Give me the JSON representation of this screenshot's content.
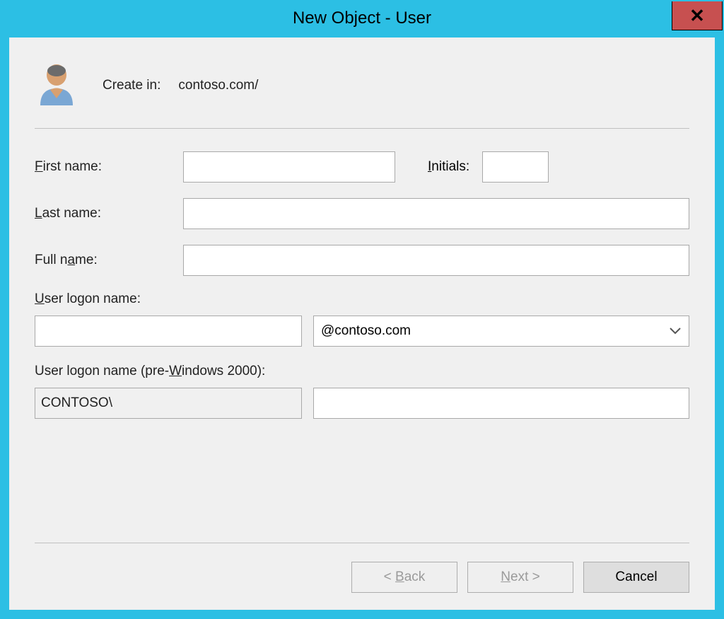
{
  "window": {
    "title": "New Object - User"
  },
  "header": {
    "create_in_label": "Create in:",
    "create_in_path": "contoso.com/"
  },
  "form": {
    "first_name_label": "irst name:",
    "first_name_prefix": "F",
    "first_name_value": "",
    "initials_label": "nitials:",
    "initials_prefix": "I",
    "initials_value": "",
    "last_name_label": "ast name:",
    "last_name_prefix": "L",
    "last_name_value": "",
    "full_name_label": "ame:",
    "full_name_prefix_plain": "Full n",
    "full_name_value": "",
    "logon_label": "ser logon name:",
    "logon_prefix": "U",
    "logon_value": "",
    "domain_selected": "@contoso.com",
    "pre2000_label_before": "User logon name (pre-",
    "pre2000_label_under": "W",
    "pre2000_label_after": "indows 2000):",
    "pre2000_domain": "CONTOSO\\",
    "pre2000_value": ""
  },
  "buttons": {
    "back": "ack",
    "back_prefix": "< ",
    "back_under": "B",
    "next": "ext >",
    "next_under": "N",
    "cancel": "Cancel"
  }
}
